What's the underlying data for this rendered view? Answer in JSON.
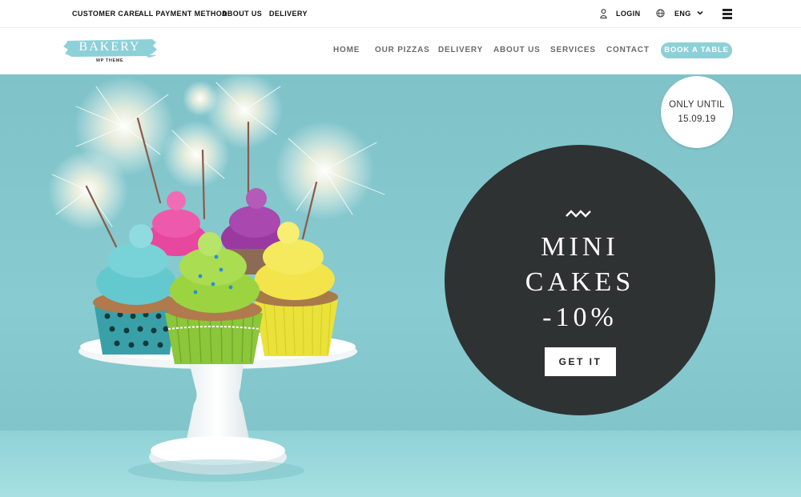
{
  "topbar": {
    "links": [
      "CUSTOMER CARE",
      "ALL PAYMENT METHOD",
      "ABOUT US",
      "DELIVERY"
    ],
    "login_label": "LOGIN",
    "language": "ENG",
    "icons": {
      "login": "user-icon",
      "language": "globe-icon",
      "chevron": "chevron-down-icon",
      "menu": "hamburger-menu-icon"
    }
  },
  "logo": {
    "wordmark": "BAKERY",
    "tagline": "WP THEME",
    "brush_color": "#8ed0d8"
  },
  "nav": {
    "items": [
      "HOME",
      "OUR PIZZAS",
      "DELIVERY",
      "ABOUT US",
      "SERVICES",
      "CONTACT"
    ],
    "cta_label": "BOOK A TABLE"
  },
  "hero": {
    "promo_lines": [
      "MINI",
      "CAKES",
      "-10%"
    ],
    "promo_button": "GET IT",
    "badge_lines": [
      "ONLY UNTIL",
      "15.09.19"
    ],
    "photo_subject": "cupcakes-with-sparklers-on-cake-stand"
  },
  "colors": {
    "accent": "#8ed0d8",
    "hero_background": "#84c7cc",
    "promo_circle": "#2f3233",
    "text_dark": "#111111"
  }
}
